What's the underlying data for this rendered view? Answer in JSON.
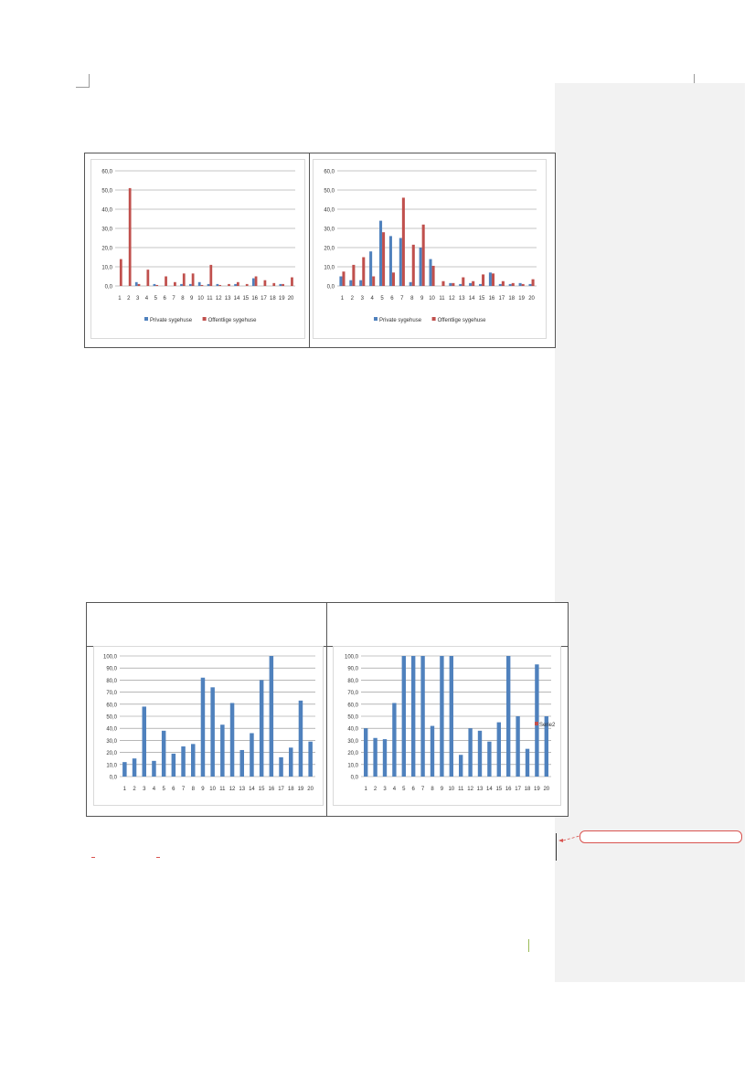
{
  "comment_pane": {
    "label": ""
  },
  "chart_data": [
    {
      "type": "bar",
      "categories": [
        "1",
        "2",
        "3",
        "4",
        "5",
        "6",
        "7",
        "8",
        "9",
        "10",
        "11",
        "12",
        "13",
        "14",
        "15",
        "16",
        "17",
        "18",
        "19",
        "20"
      ],
      "ylim": [
        0,
        60
      ],
      "yticks": [
        "0,0",
        "10,0",
        "20,0",
        "30,0",
        "40,0",
        "50,0",
        "60,0"
      ],
      "series": [
        {
          "name": "Private sygehuse",
          "color": "#4f81bd",
          "values": [
            0,
            0,
            2,
            0,
            1,
            0,
            0,
            1,
            1,
            2,
            1,
            1,
            0,
            1,
            0,
            4,
            0,
            0,
            1,
            0
          ]
        },
        {
          "name": "Offentlige sygehuse",
          "color": "#c0504d",
          "values": [
            14,
            51,
            1,
            8.5,
            0.5,
            5,
            2,
            6.5,
            6.5,
            0.5,
            11,
            0.5,
            1,
            2,
            1,
            5,
            3,
            1.5,
            1,
            4.5
          ]
        }
      ],
      "legend": "bottom"
    },
    {
      "type": "bar",
      "categories": [
        "1",
        "2",
        "3",
        "4",
        "5",
        "6",
        "7",
        "8",
        "9",
        "10",
        "11",
        "12",
        "13",
        "14",
        "15",
        "16",
        "17",
        "18",
        "19",
        "20"
      ],
      "ylim": [
        0,
        60
      ],
      "yticks": [
        "0,0",
        "10,0",
        "20,0",
        "30,0",
        "40,0",
        "50,0",
        "60,0"
      ],
      "series": [
        {
          "name": "Private sygehuse",
          "color": "#4f81bd",
          "values": [
            5,
            3,
            3,
            18,
            34,
            26,
            25,
            2,
            20,
            14,
            0,
            1.5,
            1,
            1.5,
            1,
            7,
            1,
            1,
            1.5,
            1
          ]
        },
        {
          "name": "Offentlige sygehuse",
          "color": "#c0504d",
          "values": [
            7.5,
            11,
            15,
            5,
            28,
            7,
            46,
            21.5,
            32,
            10.5,
            2.5,
            1.5,
            4.5,
            2.5,
            6,
            6.5,
            2.5,
            1.5,
            1,
            3.5
          ]
        }
      ],
      "legend": "bottom"
    },
    {
      "type": "bar",
      "categories": [
        "1",
        "2",
        "3",
        "4",
        "5",
        "6",
        "7",
        "8",
        "9",
        "10",
        "11",
        "12",
        "13",
        "14",
        "15",
        "16",
        "17",
        "18",
        "19",
        "20"
      ],
      "ylim": [
        0,
        100
      ],
      "yticks": [
        "0,0",
        "10,0",
        "20,0",
        "30,0",
        "40,0",
        "50,0",
        "60,0",
        "70,0",
        "80,0",
        "90,0",
        "100,0"
      ],
      "series": [
        {
          "name": "",
          "color": "#4f81bd",
          "values": [
            12,
            15,
            58,
            13,
            38,
            19,
            25,
            27,
            82,
            74,
            43,
            61,
            22,
            36,
            80,
            100,
            16,
            24,
            63,
            29
          ]
        }
      ]
    },
    {
      "type": "bar",
      "categories": [
        "1",
        "2",
        "3",
        "4",
        "5",
        "6",
        "7",
        "8",
        "9",
        "10",
        "11",
        "12",
        "13",
        "14",
        "15",
        "16",
        "17",
        "18",
        "19",
        "20"
      ],
      "ylim": [
        0,
        100
      ],
      "yticks": [
        "0,0",
        "10,0",
        "20,0",
        "30,0",
        "40,0",
        "50,0",
        "60,0",
        "70,0",
        "80,0",
        "90,0",
        "100,0"
      ],
      "series": [
        {
          "name": "",
          "color": "#4f81bd",
          "values": [
            40,
            32,
            31,
            61,
            100,
            100,
            100,
            42,
            100,
            100,
            18,
            40,
            38,
            29,
            45,
            100,
            50,
            23,
            93,
            50
          ]
        },
        {
          "name": "Serie2",
          "color": "#c0504d",
          "values": []
        }
      ],
      "legend": "right"
    }
  ]
}
